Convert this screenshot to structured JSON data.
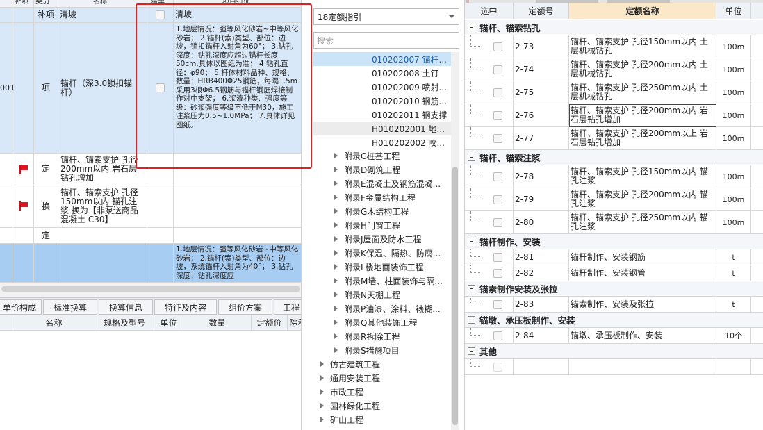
{
  "left_grid": {
    "header_fragments": {
      "col_b": "补项",
      "col_c": "类别",
      "col_d": "名称",
      "col_e": "清单",
      "col_f": "项目特征"
    },
    "rows": [
      {
        "type": "补项",
        "name": "清坡",
        "desc": "清坡"
      },
      {
        "code_fragment": "001",
        "type": "项",
        "name": "锚杆（深3.0锁扣锚杆）",
        "desc": "1.地层情况：强等风化砂岩~中等风化砂岩； 2.锚杆(索)类型、部位：边坡，锁扣锚杆入射角为60°； 3.钻孔深度：钻孔深度应超过锚杆长度50cm,具体以图纸为准； 4.钻孔直径：φ90； 5.杆体材料品种、规格、数量：HRB400Φ25钢筋，每隔1.5m采用3根Φ6.5钢筋与锚杆钢筋焊接制作对中支架； 6.浆液种类、强度等级：砂浆强度等级不低于M30，施工注浆压力0.5~1.0MPa； 7.具体详见图纸。"
      },
      {
        "type": "定",
        "name": "锚杆、锚索支护 孔径200mm以内 岩石层钻孔增加"
      },
      {
        "type": "换",
        "name": "锚杆、锚索支护 孔径150mm以内 锚孔注浆 换为【非泵送商品混凝土 C30】"
      },
      {
        "type": "定",
        "name": ""
      },
      {
        "desc": "1.地层情况：强等风化砂岩~中等风化砂岩； 2.锚杆(索)类型、部位：边坡，系统锚杆入射角为40°； 3.钻孔深度：钻孔深度应"
      }
    ],
    "tabs": [
      "单价构成",
      "标准换算",
      "换算信息",
      "特征及内容",
      "组价方案",
      "工程"
    ],
    "bottom_headers": [
      "名称",
      "规格及型号",
      "单位",
      "数量",
      "定额价",
      "除税"
    ]
  },
  "middle": {
    "dropdown_value": "18定额指引",
    "search_placeholder": "搜索",
    "code_items": [
      {
        "label": "010202007  锚杆...",
        "selected": true
      },
      {
        "label": "010202008  土钉"
      },
      {
        "label": "010202009  喷射..."
      },
      {
        "label": "010202010  钢筋..."
      },
      {
        "label": "010202011  钢支撑"
      },
      {
        "label": "H010202001  地...",
        "gray": true
      },
      {
        "label": "H010202002  咬..."
      }
    ],
    "appendix_items": [
      "附录C桩基工程",
      "附录D砌筑工程",
      "附录E混凝土及钢筋混凝...",
      "附录F金属结构工程",
      "附录G木结构工程",
      "附录H门窗工程",
      "附录J屋面及防水工程",
      "附录K保温、隔热、防腐...",
      "附录L楼地面装饰工程",
      "附录M墙、柱面装饰与隔...",
      "附录N天棚工程",
      "附录P油漆、涂料、裱糊...",
      "附录Q其他装饰工程",
      "附录R拆除工程",
      "附录S措施项目"
    ],
    "top_items": [
      "仿古建筑工程",
      "通用安装工程",
      "市政工程",
      "园林绿化工程",
      "矿山工程"
    ]
  },
  "right_grid": {
    "headers": [
      "选中",
      "定额号",
      "定额名称",
      "单位"
    ],
    "groups": [
      {
        "title": "锚杆、锚索钻孔",
        "rows": [
          {
            "code": "2-73",
            "name": "锚杆、锚索支护 孔径150mm以内 土层机械钻孔",
            "unit": "100m"
          },
          {
            "code": "2-74",
            "name": "锚杆、锚索支护 孔径200mm以内 土层机械钻孔",
            "unit": "100m"
          },
          {
            "code": "2-75",
            "name": "锚杆、锚索支护 孔径250mm以内 土层机械钻孔",
            "unit": "100m"
          },
          {
            "code": "2-76",
            "name": "锚杆、锚索支护 孔径200mm以内 岩石层钻孔增加",
            "unit": "100m"
          },
          {
            "code": "2-77",
            "name": "锚杆、锚索支护 孔径200mm以上 岩石层钻孔增加",
            "unit": "100m"
          }
        ]
      },
      {
        "title": "锚杆、锚索注浆",
        "rows": [
          {
            "code": "2-78",
            "name": "锚杆、锚索支护 孔径150mm以内 锚孔注浆",
            "unit": "100m"
          },
          {
            "code": "2-79",
            "name": "锚杆、锚索支护 孔径200mm以内 锚孔注浆",
            "unit": "100m"
          },
          {
            "code": "2-80",
            "name": "锚杆、锚索支护 孔径250mm以内 锚孔注浆",
            "unit": "100m"
          }
        ]
      },
      {
        "title": "锚杆制作、安装",
        "rows": [
          {
            "code": "2-81",
            "name": "锚杆制作、安装钢筋",
            "unit": "t"
          },
          {
            "code": "2-82",
            "name": "锚杆制作、安装钢管",
            "unit": "t"
          }
        ]
      },
      {
        "title": "锚索制作安装及张拉",
        "rows": [
          {
            "code": "2-83",
            "name": "锚索制作、安装及张拉",
            "unit": "t"
          }
        ]
      },
      {
        "title": "锚墩、承压板制作、安装",
        "rows": [
          {
            "code": "2-84",
            "name": "锚墩、承压板制作、安装",
            "unit": "10个"
          }
        ]
      },
      {
        "title": "其他",
        "rows": [
          {
            "code": "",
            "name": "",
            "unit": ""
          }
        ]
      }
    ]
  },
  "colors": {
    "highlight_border": "#e02020",
    "row_blue": "#d9e8f8",
    "row_selected": "#a8cdf2",
    "tree_selected": "#cce4f7",
    "code_blue": "#1a5fb4"
  }
}
